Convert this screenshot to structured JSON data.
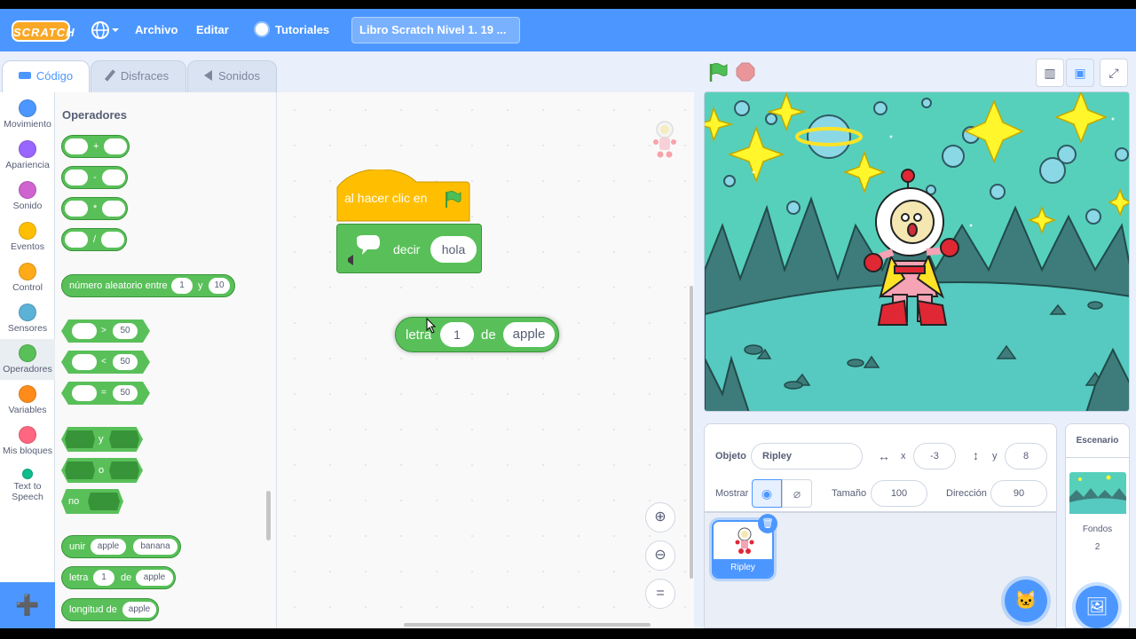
{
  "menu": {
    "logo": "SCRATCH",
    "items": [
      "Archivo",
      "Editar"
    ],
    "tutorials": "Tutoriales",
    "project_title": "Libro Scratch Nivel 1. 19 ..."
  },
  "tabs": [
    {
      "label": "Código"
    },
    {
      "label": "Disfraces"
    },
    {
      "label": "Sonidos"
    }
  ],
  "categories": [
    {
      "label": "Movimiento",
      "color": "#4c97ff"
    },
    {
      "label": "Apariencia",
      "color": "#9966ff"
    },
    {
      "label": "Sonido",
      "color": "#cf63cf"
    },
    {
      "label": "Eventos",
      "color": "#ffbf00"
    },
    {
      "label": "Control",
      "color": "#ffab19"
    },
    {
      "label": "Sensores",
      "color": "#5cb1d6"
    },
    {
      "label": "Operadores",
      "color": "#59c059"
    },
    {
      "label": "Variables",
      "color": "#ff8c1a"
    },
    {
      "label": "Mis bloques",
      "color": "#ff6680"
    },
    {
      "label": "Text to Speech",
      "color": "#0fbd8c"
    }
  ],
  "palette": {
    "title": "Operadores",
    "arith_ops": [
      "+",
      "-",
      "*",
      "/"
    ],
    "random": {
      "label": "número aleatorio entre",
      "a": "1",
      "and": "y",
      "b": "10"
    },
    "compare": [
      {
        "op": ">",
        "value": "50"
      },
      {
        "op": "<",
        "value": "50"
      },
      {
        "op": "=",
        "value": "50"
      }
    ],
    "logic": [
      "y",
      "o",
      "no"
    ],
    "join": {
      "label": "unir",
      "a": "apple",
      "b": "banana"
    },
    "letter": {
      "label": "letra",
      "n": "1",
      "of": "de",
      "text": "apple"
    },
    "length": {
      "label": "longitud de",
      "text": "apple"
    }
  },
  "workspace": {
    "hat_block": "al hacer clic en",
    "say_block": {
      "label": "decir",
      "value": "hola"
    },
    "letter_block": {
      "label": "letra",
      "n": "1",
      "of": "de",
      "text": "apple"
    }
  },
  "sprite_info": {
    "object_label": "Objeto",
    "object_name": "Ripley",
    "x_label": "x",
    "x": "-3",
    "y_label": "y",
    "y": "8",
    "show_label": "Mostrar",
    "size_label": "Tamaño",
    "size": "100",
    "direction_label": "Dirección",
    "direction": "90"
  },
  "sprites": [
    {
      "name": "Ripley"
    }
  ],
  "stage_panel": {
    "title": "Escenario",
    "backdrops_label": "Fondos",
    "backdrops_count": "2"
  },
  "colors": {
    "menu": "#4c97ff",
    "operators": "#59c059",
    "events": "#ffbf00",
    "looks": "#9966ff"
  }
}
